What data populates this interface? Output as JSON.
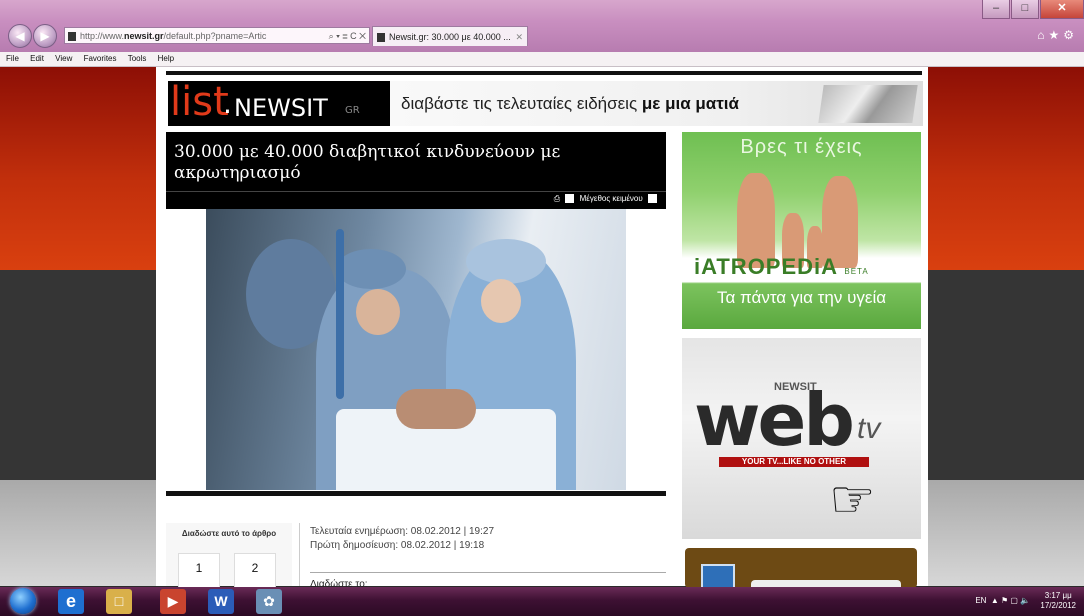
{
  "browser": {
    "address_prefix": "http://www.",
    "address_domain": "newsit.gr",
    "address_rest": "/default.php?pname=Artic",
    "address_controls": "⌕ ▾ ≣ C ✕",
    "tab_title": "Newsit.gr: 30.000 με 40.000 ...",
    "tab_close": "✕",
    "window_controls": [
      "–",
      "□",
      "✕"
    ],
    "right_icons": "⌂★⚙",
    "menu": [
      "File",
      "Edit",
      "View",
      "Favorites",
      "Tools",
      "Help"
    ]
  },
  "site": {
    "logo_list": "list",
    "logo_dot": ".",
    "logo_news": "NEWSIT",
    "logo_gr": "GR",
    "tagline_plain": "διαβάστε τις τελευταίες ειδήσεις ",
    "tagline_bold": "με μια ματιά"
  },
  "article": {
    "headline": "30.000 με 40.000 διαβητικοί κινδυνεύουν με ακρωτηριασμό",
    "font_size_label": "Μέγεθος κειμένου",
    "updated": "Τελευταία ενημέρωση: 08.02.2012 | 19:27",
    "published": "Πρώτη δημοσίευση: 08.02.2012 | 19:18",
    "share_label": "Διαδώστε αυτό το άρθρο",
    "share_counts": [
      "1",
      "2"
    ],
    "share_to": "Διαδώστε το:"
  },
  "ads": {
    "iatropedia_top": "Βρες τι έχεις",
    "iatropedia_brand": "iATROPEDiA",
    "iatropedia_beta": "BETA",
    "iatropedia_slogan": "Τα πάντα για την υγεία",
    "webtv_newsit": "NEWSIT",
    "webtv_web": "web",
    "webtv_tv": "tv",
    "webtv_slogan": "YOUR TV...LIKE NO OTHER"
  },
  "taskbar": {
    "lang": "EN",
    "time": "3:17 μμ",
    "date": "17/2/2012"
  },
  "colors": {
    "page_red": "#c12f0c",
    "logo_red": "#e13a1a",
    "iatropedia_green": "#6fbf52",
    "webtv_red": "#b01010"
  }
}
